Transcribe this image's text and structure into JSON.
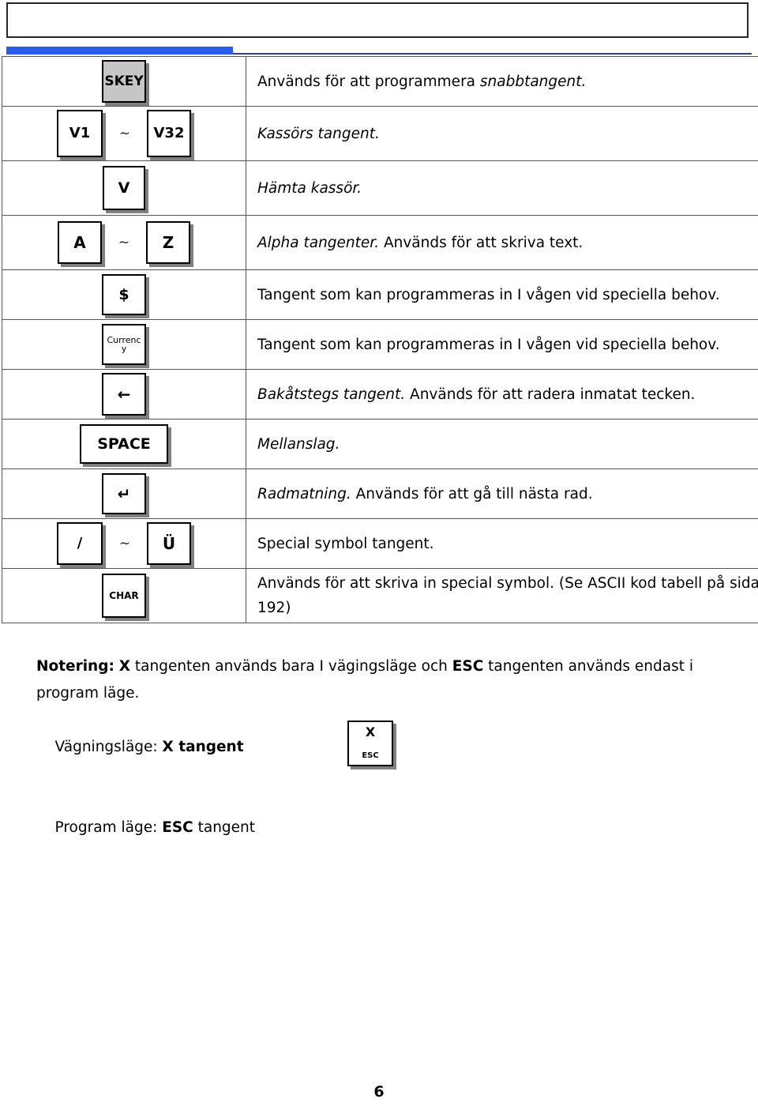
{
  "document": {
    "page_number": "6",
    "accent_blue_thick": "#2b5ce8",
    "accent_blue_thin": "#2d3f8c",
    "key_shadow": "#808080",
    "skey_fill": "#c6c6c6"
  },
  "header": {
    "box_text": ""
  },
  "table": {
    "rows": [
      {
        "keys": [
          {
            "name": "skey-key",
            "label": "SKEY",
            "style": "gray"
          }
        ],
        "range": false,
        "desc_parts": [
          {
            "text": "Används för att programmera ",
            "italic": false
          },
          {
            "text": "snabbtangent.",
            "italic": true
          }
        ],
        "desc_plain": "Används för att programmera snabbtangent."
      },
      {
        "keys": [
          {
            "name": "v1-key",
            "label": "V1",
            "style": "white"
          },
          {
            "name": "v32-key",
            "label": "V32",
            "style": "white"
          }
        ],
        "range": true,
        "range_symbol": "~",
        "desc_parts": [
          {
            "text": "Kassörs tangent.",
            "italic": true
          }
        ],
        "desc_plain": "Kassörs tangent."
      },
      {
        "keys": [
          {
            "name": "v-key",
            "label": "V",
            "style": "white"
          }
        ],
        "range": false,
        "desc_parts": [
          {
            "text": "Hämta kassör.",
            "italic": true
          }
        ],
        "desc_plain": "Hämta kassör."
      },
      {
        "keys": [
          {
            "name": "a-key",
            "label": "A",
            "style": "white"
          },
          {
            "name": "z-key",
            "label": "Z",
            "style": "white"
          }
        ],
        "range": true,
        "range_symbol": "~",
        "desc_parts": [
          {
            "text": "Alpha tangenter.",
            "italic": true
          },
          {
            "text": "   Används för att skriva text.",
            "italic": false
          }
        ],
        "desc_plain": "Alpha tangenter.   Används för att skriva text."
      },
      {
        "keys": [
          {
            "name": "dollar-key",
            "label": "$",
            "style": "white"
          }
        ],
        "range": false,
        "desc_parts": [
          {
            "text": "Tangent som kan programmeras in I vågen vid speciella behov.",
            "italic": false
          }
        ],
        "desc_plain": "Tangent som kan programmeras in I vågen vid speciella behov."
      },
      {
        "keys": [
          {
            "name": "currency-key",
            "label": "Currenc\ny",
            "style": "white"
          }
        ],
        "range": false,
        "desc_parts": [
          {
            "text": "Tangent som kan programmeras in I vågen vid speciella behov.",
            "italic": false
          }
        ],
        "desc_plain": "Tangent som kan programmeras in I vågen vid speciella behov."
      },
      {
        "keys": [
          {
            "name": "backspace-key",
            "label": "←",
            "style": "white"
          }
        ],
        "range": false,
        "desc_parts": [
          {
            "text": "Bakåtstegs tangent.",
            "italic": true
          },
          {
            "text": " Används för att radera inmatat tecken.",
            "italic": false
          }
        ],
        "desc_plain": "Bakåtstegs tangent. Används för att radera inmatat tecken."
      },
      {
        "keys": [
          {
            "name": "space-key",
            "label": "SPACE",
            "style": "white"
          }
        ],
        "range": false,
        "desc_parts": [
          {
            "text": "Mellanslag.",
            "italic": true
          }
        ],
        "desc_plain": "Mellanslag."
      },
      {
        "keys": [
          {
            "name": "enter-key",
            "label": "↵",
            "style": "white"
          }
        ],
        "range": false,
        "desc_parts": [
          {
            "text": "Radmatning.",
            "italic": true
          },
          {
            "text": " Används för att gå till nästa rad.",
            "italic": false
          }
        ],
        "desc_plain": "Radmatning. Används för att gå till nästa rad."
      },
      {
        "keys": [
          {
            "name": "slash-key",
            "label": "/",
            "style": "white"
          },
          {
            "name": "uumlaut-key",
            "label": "Ü",
            "style": "white"
          }
        ],
        "range": true,
        "range_symbol": "~",
        "desc_parts": [
          {
            "text": "Special symbol tangent.",
            "italic": false
          }
        ],
        "desc_plain": "Special symbol tangent."
      },
      {
        "keys": [
          {
            "name": "char-key",
            "label": "CHAR",
            "style": "white"
          }
        ],
        "range": false,
        "desc_parts": [
          {
            "text": "Används för att skriva in special symbol. (Se ASCII kod tabell på sida 192)",
            "italic": false
          }
        ],
        "desc_plain": "Används för att skriva in special symbol. (Se ASCII kod tabell på sida 192)"
      }
    ]
  },
  "note": {
    "label": "Notering:",
    "paragraph_pre": " ",
    "x_bold": "X",
    "mid1": " tangenten används bara I vägingsläge och ",
    "esc_bold": "ESC",
    "mid2": " tangenten används endast i program läge.",
    "line2_prefix": "Vägningsläge: ",
    "line2_bold": "X tangent",
    "line3_prefix": "Program läge: ",
    "line3_bold": "ESC",
    "line3_suffix": " tangent",
    "key": {
      "name": "x-esc-key",
      "main_label": "X",
      "sub_label": "ESC"
    }
  }
}
